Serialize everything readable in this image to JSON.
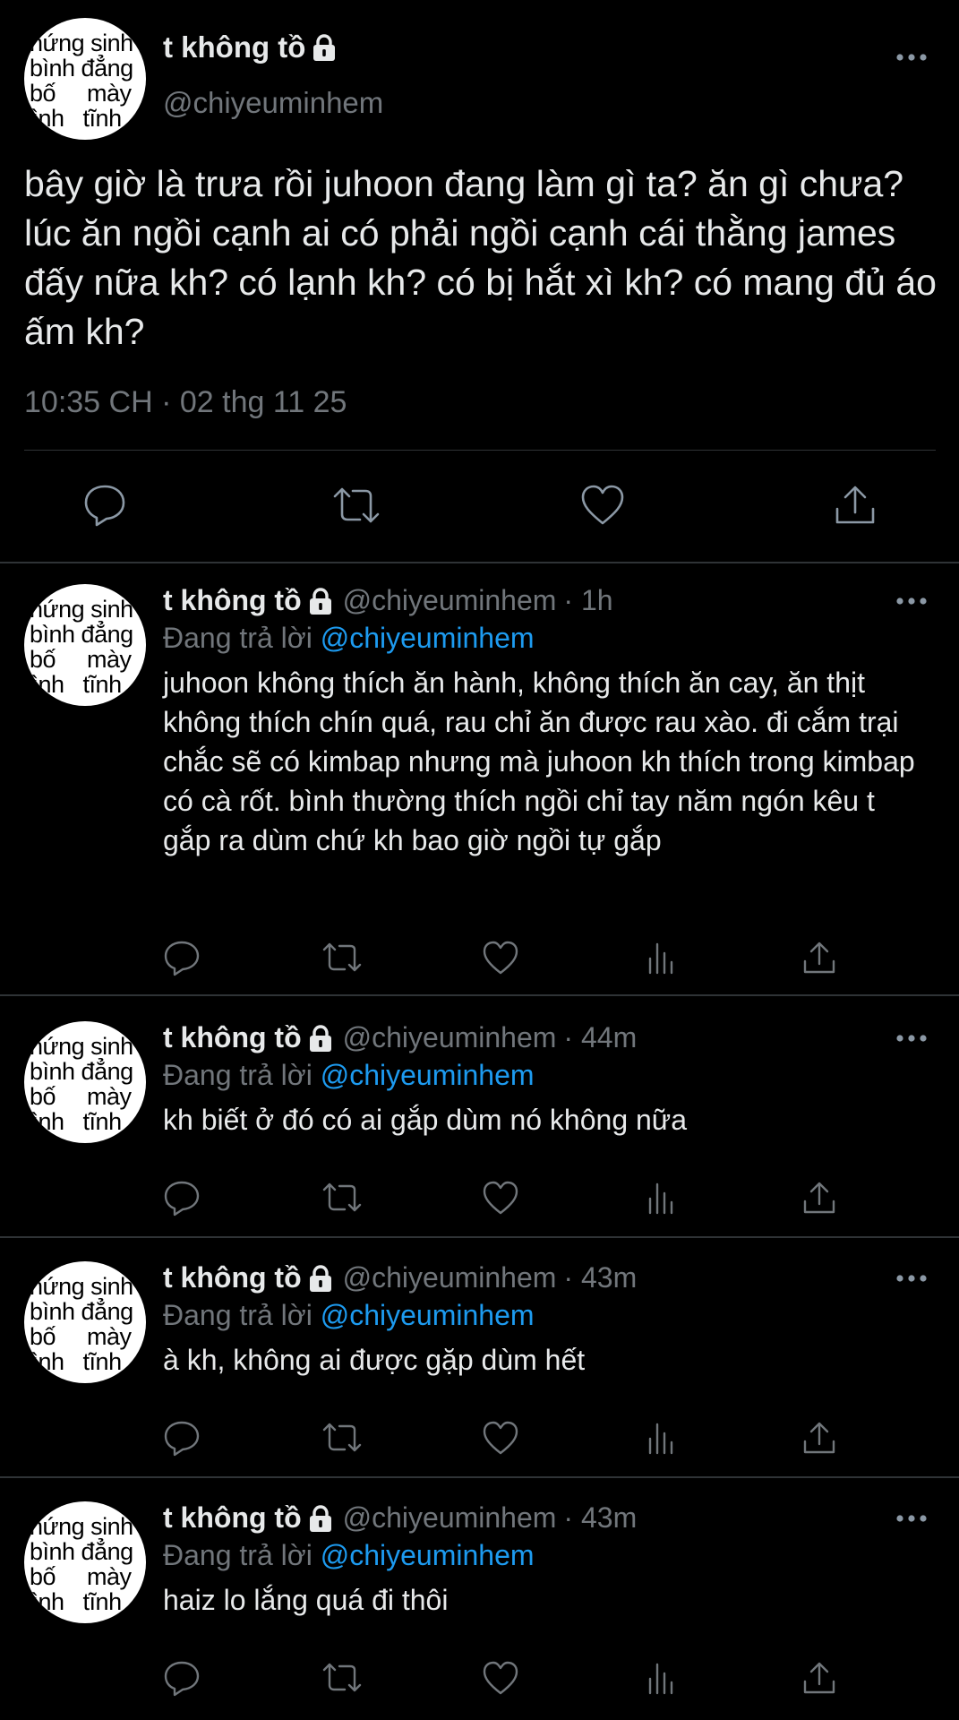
{
  "main_tweet": {
    "avatar_lines": [
      "hứng sinh",
      "bình đẳng",
      "bố     mày",
      "bình   tĩnh"
    ],
    "display_name": "t không tồ",
    "handle": "@chiyeuminhem",
    "text": "bây giờ là trưa rồi juhoon đang làm gì ta? ăn gì chưa? lúc ăn ngồi cạnh ai có phải ngồi cạnh cái thằng james đấy nữa kh? có lạnh kh? có bị hắt xì kh? có mang đủ áo ấm kh?",
    "timestamp": "10:35 CH · 02 thg 11 25",
    "icons": [
      "lock-icon",
      "more-icon",
      "reply-icon",
      "retweet-icon",
      "like-icon",
      "share-icon"
    ]
  },
  "replies": [
    {
      "display_name": "t không tồ",
      "handle": "@chiyeuminhem",
      "time": "· 1h",
      "replying_prefix": "Đang trả lời",
      "replying_to": "@chiyeuminhem",
      "text": "juhoon không thích ăn hành, không thích ăn cay, ăn thịt không thích chín quá, rau chỉ ăn được rau xào. đi cắm trại chắc sẽ có kimbap nhưng mà juhoon kh thích trong kimbap có cà rốt. bình thường thích ngồi chỉ tay năm ngón kêu t gắp ra dùm chứ kh bao giờ ngồi tự gắp"
    },
    {
      "display_name": "t không tồ",
      "handle": "@chiyeuminhem",
      "time": "· 44m",
      "replying_prefix": "Đang trả lời",
      "replying_to": "@chiyeuminhem",
      "text": "kh biết ở đó có ai gắp dùm nó không nữa"
    },
    {
      "display_name": "t không tồ",
      "handle": "@chiyeuminhem",
      "time": "· 43m",
      "replying_prefix": "Đang trả lời",
      "replying_to": "@chiyeuminhem",
      "text": "à kh, không ai được gặp dùm hết"
    },
    {
      "display_name": "t không tồ",
      "handle": "@chiyeuminhem",
      "time": "· 43m",
      "replying_prefix": "Đang trả lời",
      "replying_to": "@chiyeuminhem",
      "text": "haiz lo lắng quá đi thôi"
    }
  ],
  "colors": {
    "background": "#000000",
    "text": "#e7e9ea",
    "secondary": "#71767b",
    "mention": "#1d9bf0",
    "divider": "#2f3336"
  }
}
